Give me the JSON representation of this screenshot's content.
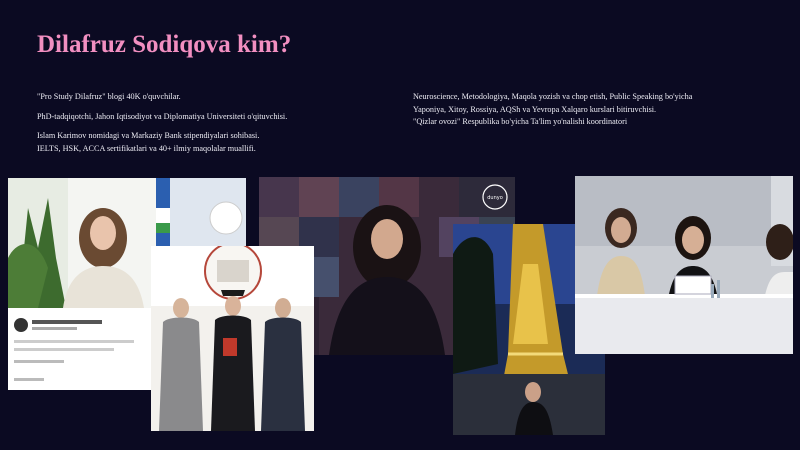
{
  "slide": {
    "title": "Dilafruz Sodiqova kim?",
    "left_paragraphs": [
      "\"Pro Study Dilafruz\" blogi 40K o'quvchilar.",
      "PhD-tadqiqotchi, Jahon Iqtisodiyot va Diplomatiya Universiteti o'qituvchisi.",
      "Islam Karimov nomidagi va Markaziy Bank  stipendiyalari sohibasi.",
      "IELTS, HSK, ACCA sertifikatlari va 40+ ilmiy maqolalar muallifi."
    ],
    "right_lines": [
      "Neuroscience, Metodologiya, Maqola yozish va chop etish, Public Speaking bo'yicha",
      "Yaponiya, Xitoy, Rossiya, AQSh va Yevropa Xalqaro kurslari bitiruvchisi.",
      "\"Qizlar ovozi\" Respublika bo'yicha Ta'lim yo'nalishi koordinatori"
    ],
    "photo3_logo": "dunyo"
  }
}
